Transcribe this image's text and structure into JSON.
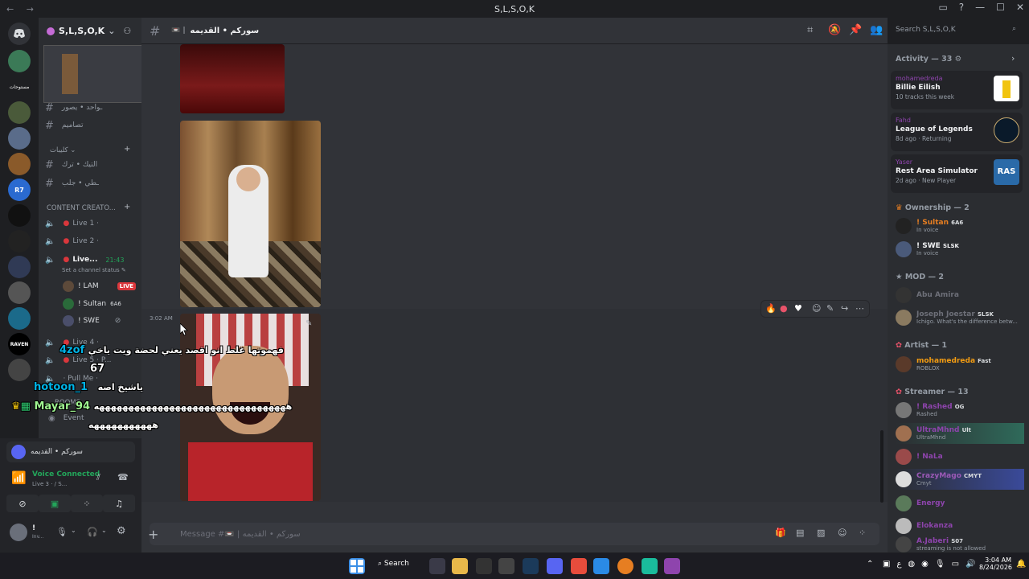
{
  "window": {
    "title": "S,L,S,O,K",
    "nav": "← →"
  },
  "server": {
    "name": "S,L,S,O,K",
    "guild_labels": [
      "مستوحات",
      "RAVEN",
      "R7"
    ]
  },
  "channels": {
    "items": [
      {
        "label": "ـواحد • يصور"
      },
      {
        "label": "تصاميم"
      },
      {
        "label": "التيك • ترك"
      },
      {
        "label": "ـطي • جلب"
      }
    ],
    "category_kalibat": "كليبات",
    "category_content": "CONTENT CREATO...",
    "voice": [
      {
        "label": "Live 1 ·"
      },
      {
        "label": "Live 2 ·"
      },
      {
        "label": "Live...",
        "time": "21:43"
      },
      {
        "label": "Live 4 ·"
      },
      {
        "label": "Live 5 · P..."
      },
      {
        "label": "· Pull Me ·"
      }
    ],
    "channel_status": "Set a channel status",
    "voice_users": [
      {
        "name": "! LAM",
        "badge": "LIVE"
      },
      {
        "name": "! Sultan",
        "badge": "6A6"
      },
      {
        "name": "! SWE",
        "badge": ""
      }
    ],
    "rooms_label": "ROOMS",
    "event_label": "Event"
  },
  "header": {
    "channel": "سوركم • القديمه"
  },
  "message": {
    "timestamp": "3:02 AM"
  },
  "composer": {
    "placeholder": "Message #📼 | سوركم • القديمه"
  },
  "members": {
    "search_placeholder": "Search S,L,S,O,K",
    "activity_header": "Activity — 33",
    "activities": [
      {
        "user": "mohamedreda",
        "name": "Billie Eilish",
        "sub": "10 tracks this week"
      },
      {
        "user": "Fahd",
        "name": "League of Legends",
        "sub": "8d ago · Returning"
      },
      {
        "user": "Yaser",
        "name": "Rest Area Simulator",
        "sub": "2d ago · New Player"
      }
    ],
    "sections": [
      {
        "title": "Ownership — 2",
        "members": [
          {
            "name": "! Sultan",
            "tag": "6A6",
            "status": "In voice"
          },
          {
            "name": "! SWE",
            "tag": "SLSK",
            "status": "In voice"
          }
        ]
      },
      {
        "title": "MOD — 2",
        "members": [
          {
            "name": "Abu Amira",
            "tag": "",
            "status": ""
          },
          {
            "name": "Joseph Joestar",
            "tag": "SLSK",
            "status": "Ichigo. What's the difference betw..."
          }
        ]
      },
      {
        "title": "Artist — 1",
        "members": [
          {
            "name": "mohamedreda",
            "tag": "Fast",
            "status": "ROBLOX"
          }
        ]
      },
      {
        "title": "Streamer — 13",
        "members": [
          {
            "name": "! Rashed",
            "tag": "OG",
            "status": "Rashed"
          },
          {
            "name": "UltraMhnd",
            "tag": "Ult",
            "status": "UltraMhnd"
          },
          {
            "name": "! NaLa",
            "tag": "",
            "status": ""
          },
          {
            "name": "CrazyMago",
            "tag": "CMYT",
            "status": "Cmyt"
          },
          {
            "name": "Energy",
            "tag": "",
            "status": ""
          },
          {
            "name": "Elokanza",
            "tag": "",
            "status": ""
          },
          {
            "name": "A.Jaberi",
            "tag": "S07",
            "status": "streaming is not allowed"
          }
        ]
      }
    ]
  },
  "userbar": {
    "channel": "سوركم • القديمه",
    "voice_status": "Voice Connected",
    "voice_sub": "Live 3 · / S...",
    "user": "!",
    "user_sub": "Inv..."
  },
  "overlay": {
    "lines": [
      {
        "user": "4zof",
        "text": "فهموتها غلط انو اقصد يعني لحضة ويت ياخي"
      },
      {
        "user": "",
        "text": "67"
      },
      {
        "user": "hotoon_1",
        "text": "ياشيخ اصه"
      },
      {
        "user": "Mayar_94",
        "text": "هههههههههههههههههههههههههههههههههه"
      },
      {
        "user": "",
        "text": "هههههههههههه"
      }
    ]
  },
  "taskbar": {
    "search": "Search",
    "time": "3:04 AM",
    "date": "8/24/2026"
  },
  "colors": {
    "bg": "#313338",
    "sidebar": "#2b2d31",
    "accent": "#5865f2",
    "live_red": "#da373c",
    "online_green": "#23a55a",
    "overlay_cyan": "#00b3e6",
    "overlay_green": "#9ff590",
    "orange_name": "#f39c12"
  }
}
